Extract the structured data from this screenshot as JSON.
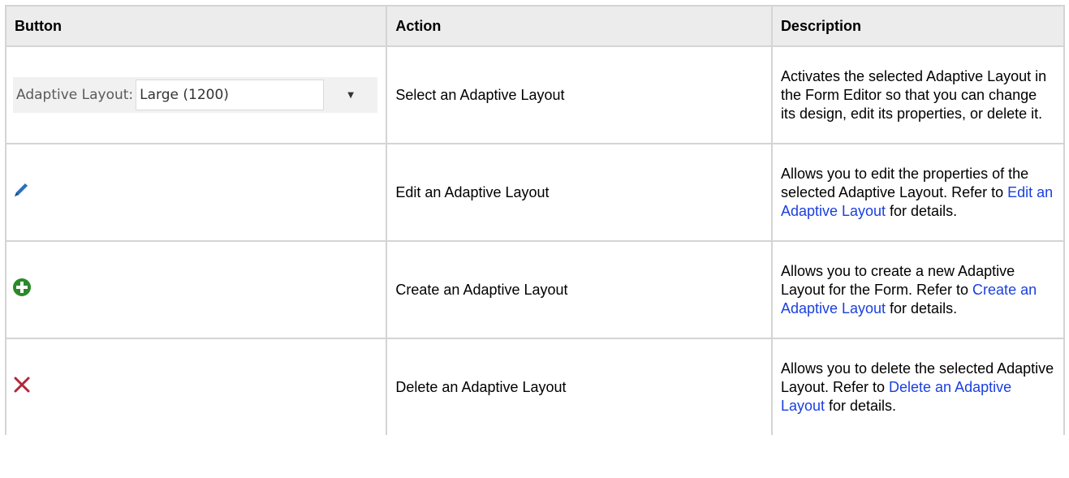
{
  "headers": {
    "button": "Button",
    "action": "Action",
    "description": "Description"
  },
  "rows": [
    {
      "action": "Select an Adaptive Layout",
      "description": [
        "Activates the selected Adaptive Layout in the Form Editor so that you can change its design, edit its properties, or delete it."
      ],
      "control": {
        "label": "Adaptive Layout:",
        "value": "Large (1200)"
      }
    },
    {
      "icon": "pencil-edit-icon",
      "action": "Edit an Adaptive Layout",
      "description_before": "Allows you to edit the properties of the selected Adaptive Layout. Refer to ",
      "link": "Edit an Adaptive Layout",
      "description_after": " for details."
    },
    {
      "icon": "green-plus-circle-icon",
      "action": "Create an Adaptive Layout",
      "description_before": "Allows you to create a new Adaptive Layout for the Form. Refer to ",
      "link": "Create an Adaptive Layout",
      "description_after": " for details."
    },
    {
      "icon": "red-x-delete-icon",
      "action": "Delete an Adaptive Layout",
      "description_before": "Allows you to delete the selected Adaptive Layout. Refer to ",
      "link": "Delete an Adaptive Layout",
      "description_after": " for details."
    }
  ],
  "colors": {
    "link": "#1a3fe0",
    "header_bg": "#ececec",
    "border": "#d4d4d4",
    "edit_icon": "#2c6fb8",
    "create_icon": "#2a8a2a",
    "delete_icon": "#b0283a"
  }
}
